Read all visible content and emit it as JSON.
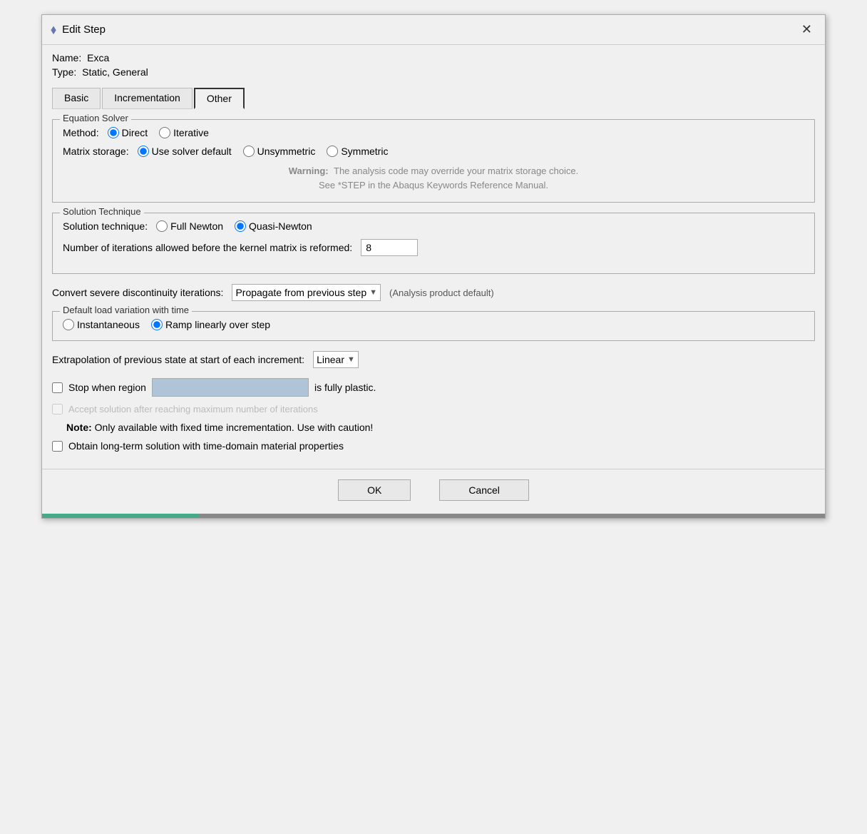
{
  "titleBar": {
    "icon": "⬧",
    "title": "Edit Step",
    "closeLabel": "✕"
  },
  "info": {
    "nameLabel": "Name:",
    "nameValue": "Exca",
    "typeLabel": "Type:",
    "typeValue": "Static, General"
  },
  "tabs": [
    {
      "id": "basic",
      "label": "Basic",
      "active": false
    },
    {
      "id": "incrementation",
      "label": "Incrementation",
      "active": false
    },
    {
      "id": "other",
      "label": "Other",
      "active": true
    }
  ],
  "equationSolver": {
    "groupLabel": "Equation Solver",
    "methodLabel": "Method:",
    "methodOptions": [
      {
        "id": "direct",
        "label": "Direct",
        "checked": true
      },
      {
        "id": "iterative",
        "label": "Iterative",
        "checked": false
      }
    ],
    "matrixLabel": "Matrix storage:",
    "matrixOptions": [
      {
        "id": "solver_default",
        "label": "Use solver default",
        "checked": true
      },
      {
        "id": "unsymmetric",
        "label": "Unsymmetric",
        "checked": false
      },
      {
        "id": "symmetric",
        "label": "Symmetric",
        "checked": false
      }
    ],
    "warningLabel": "Warning:",
    "warningText": "The analysis code may override your matrix storage choice.",
    "warningText2": "See *STEP in the Abaqus Keywords Reference Manual."
  },
  "solutionTechnique": {
    "groupLabel": "Solution Technique",
    "techniqueLabel": "Solution technique:",
    "techniqueOptions": [
      {
        "id": "full_newton",
        "label": "Full Newton",
        "checked": false
      },
      {
        "id": "quasi_newton",
        "label": "Quasi-Newton",
        "checked": true
      }
    ],
    "iterationsLabel": "Number of iterations allowed before the kernel matrix is reformed:",
    "iterationsValue": "8"
  },
  "discontinuity": {
    "label": "Convert severe discontinuity iterations:",
    "dropdownValue": "Propagate from previous step",
    "note": "(Analysis product default)"
  },
  "loadVariation": {
    "groupLabel": "Default load variation with time",
    "options": [
      {
        "id": "instantaneous",
        "label": "Instantaneous",
        "checked": false
      },
      {
        "id": "ramp",
        "label": "Ramp linearly over step",
        "checked": true
      }
    ]
  },
  "extrapolation": {
    "label": "Extrapolation of previous state at start of each increment:",
    "dropdownValue": "Linear"
  },
  "stopWhenRegion": {
    "checkboxLabel": "Stop when region",
    "checked": false,
    "suffix": "is fully plastic."
  },
  "acceptSolution": {
    "label": "Accept solution after reaching maximum number of iterations",
    "checked": false,
    "disabled": true
  },
  "noteRow": {
    "boldPart": "Note:",
    "normalPart": "  Only available with fixed time incrementation. Use with caution!"
  },
  "obtainLongTerm": {
    "label": "Obtain long-term solution with time-domain material properties",
    "checked": false
  },
  "buttons": {
    "ok": "OK",
    "cancel": "Cancel"
  }
}
